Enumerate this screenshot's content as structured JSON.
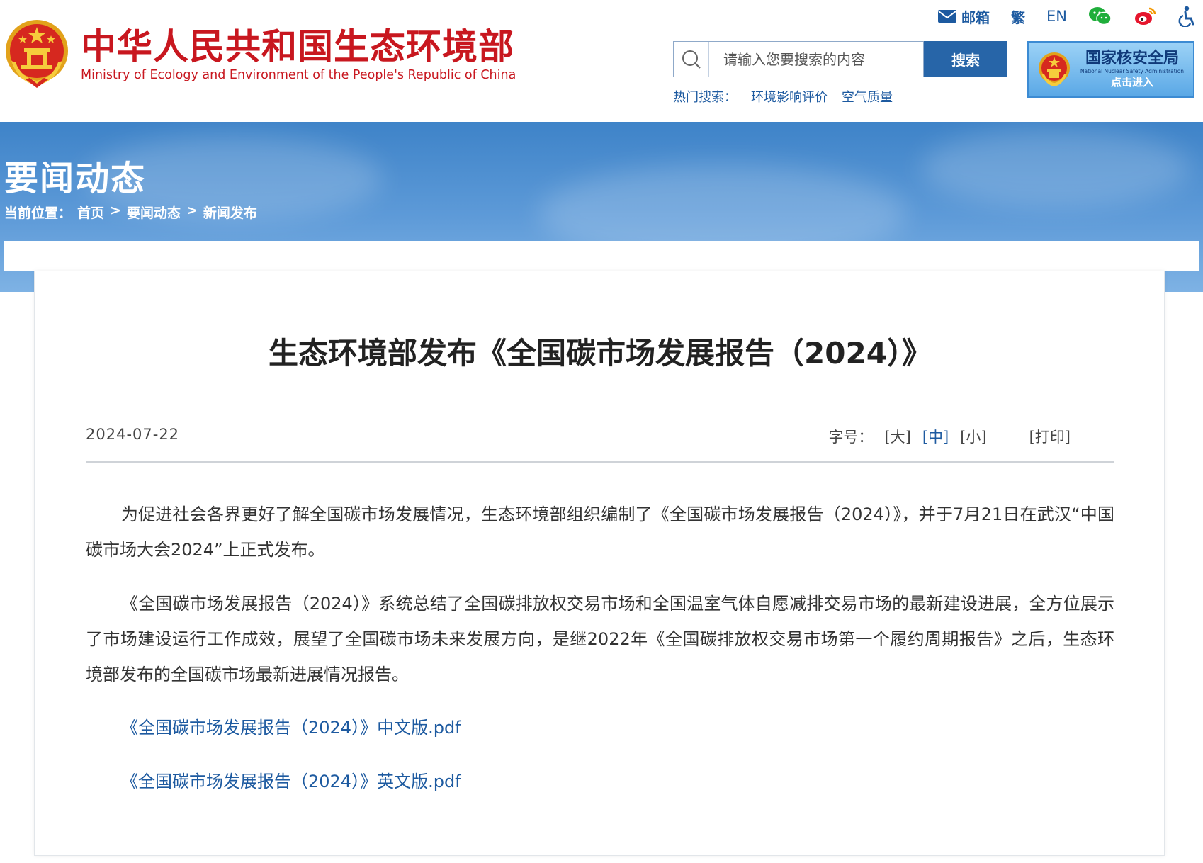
{
  "header": {
    "title_cn": "中华人民共和国生态环境部",
    "title_en": "Ministry of Ecology and Environment of the People's Republic of China",
    "top_links": {
      "mail": "邮箱",
      "traditional": "繁",
      "english": "EN"
    },
    "search": {
      "placeholder": "请输入您要搜索的内容",
      "button": "搜索"
    },
    "hot_search": {
      "label": "热门搜索：",
      "items": [
        "环境影响评价",
        "空气质量"
      ]
    },
    "nnsa": {
      "title": "国家核安全局",
      "subtitle": "National Nuclear Safety Administration",
      "enter": "点击进入"
    },
    "colors": {
      "brand_red": "#c8171f",
      "link_blue": "#1d5aa0",
      "banner_blue": "#3e83c8"
    }
  },
  "banner": {
    "section_title": "要闻动态",
    "breadcrumb": {
      "label": "当前位置：",
      "home": "首页",
      "sep": ">",
      "section": "要闻动态",
      "current": "新闻发布"
    }
  },
  "article": {
    "title": "生态环境部发布《全国碳市场发展报告（2024）》",
    "date": "2024-07-22",
    "font_size_label": "字号：",
    "font_sizes": [
      "[大]",
      "[中]",
      "[小]"
    ],
    "print": "[打印]",
    "paragraphs": [
      "为促进社会各界更好了解全国碳市场发展情况，生态环境部组织编制了《全国碳市场发展报告（2024）》，并于7月21日在武汉“中国碳市场大会2024”上正式发布。",
      "《全国碳市场发展报告（2024）》系统总结了全国碳排放权交易市场和全国温室气体自愿减排交易市场的最新建设进展，全方位展示了市场建设运行工作成效，展望了全国碳市场未来发展方向，是继2022年《全国碳排放权交易市场第一个履约周期报告》之后，生态环境部发布的全国碳市场最新进展情况报告。"
    ],
    "attachments": [
      "《全国碳市场发展报告（2024）》中文版.pdf",
      "《全国碳市场发展报告（2024）》英文版.pdf"
    ]
  }
}
